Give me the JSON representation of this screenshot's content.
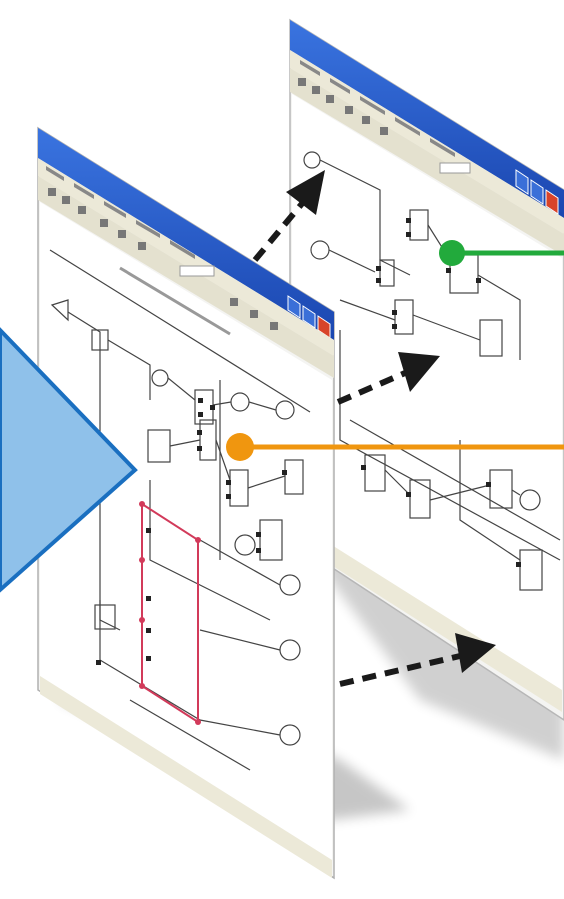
{
  "illustration": {
    "description_free": true,
    "windows": [
      {
        "id": "back",
        "title_text": ""
      },
      {
        "id": "front",
        "title_text": ""
      }
    ],
    "callouts": [
      {
        "id": "green",
        "color": "#22aa3c"
      },
      {
        "id": "orange",
        "color": "#f0960f"
      }
    ],
    "colors": {
      "title_bar": "#1f56c8",
      "pointer_fill": "#8fc1ea",
      "pointer_stroke": "#1a6fc0",
      "diagram_line": "#444444",
      "highlight_box": "#d23a5a",
      "arrow": "#1a1a1a"
    }
  }
}
